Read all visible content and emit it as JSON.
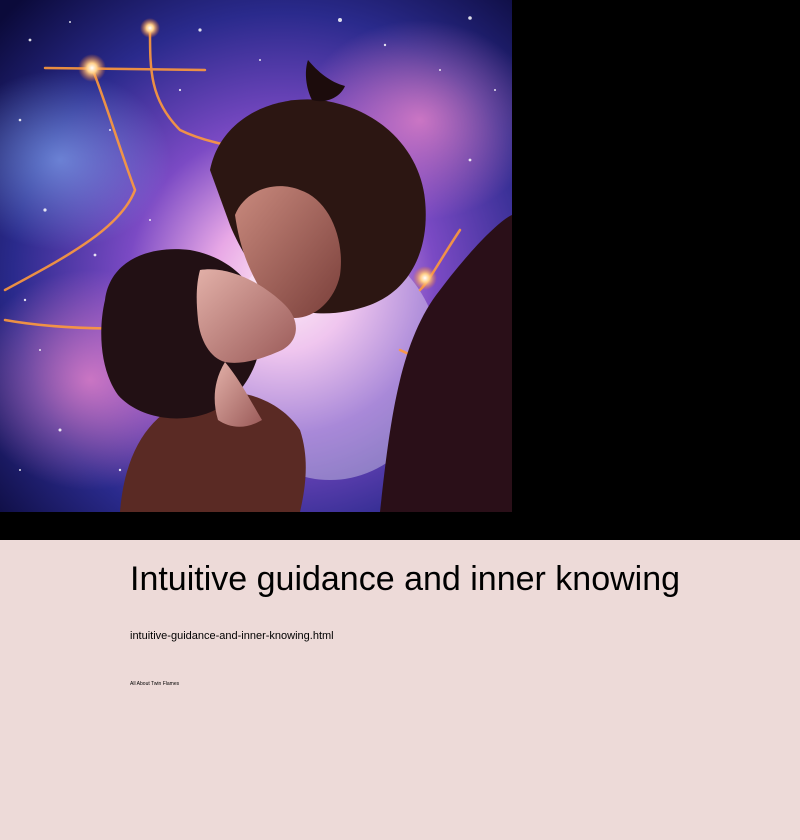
{
  "hero": {
    "image_alt": "Twin flames kissing under a cosmic sky with glowing constellation lines",
    "colors": {
      "background": "#000000",
      "space_deep": "#0b0a3a",
      "space_purple": "#6a3aa8",
      "glow_orange": "#ff9a3c"
    }
  },
  "content": {
    "background_color": "#eddad8",
    "title": "Intuitive guidance and inner knowing",
    "file_link": "intuitive-guidance-and-inner-knowing.html",
    "footer_link": "All About Twin Flames"
  }
}
